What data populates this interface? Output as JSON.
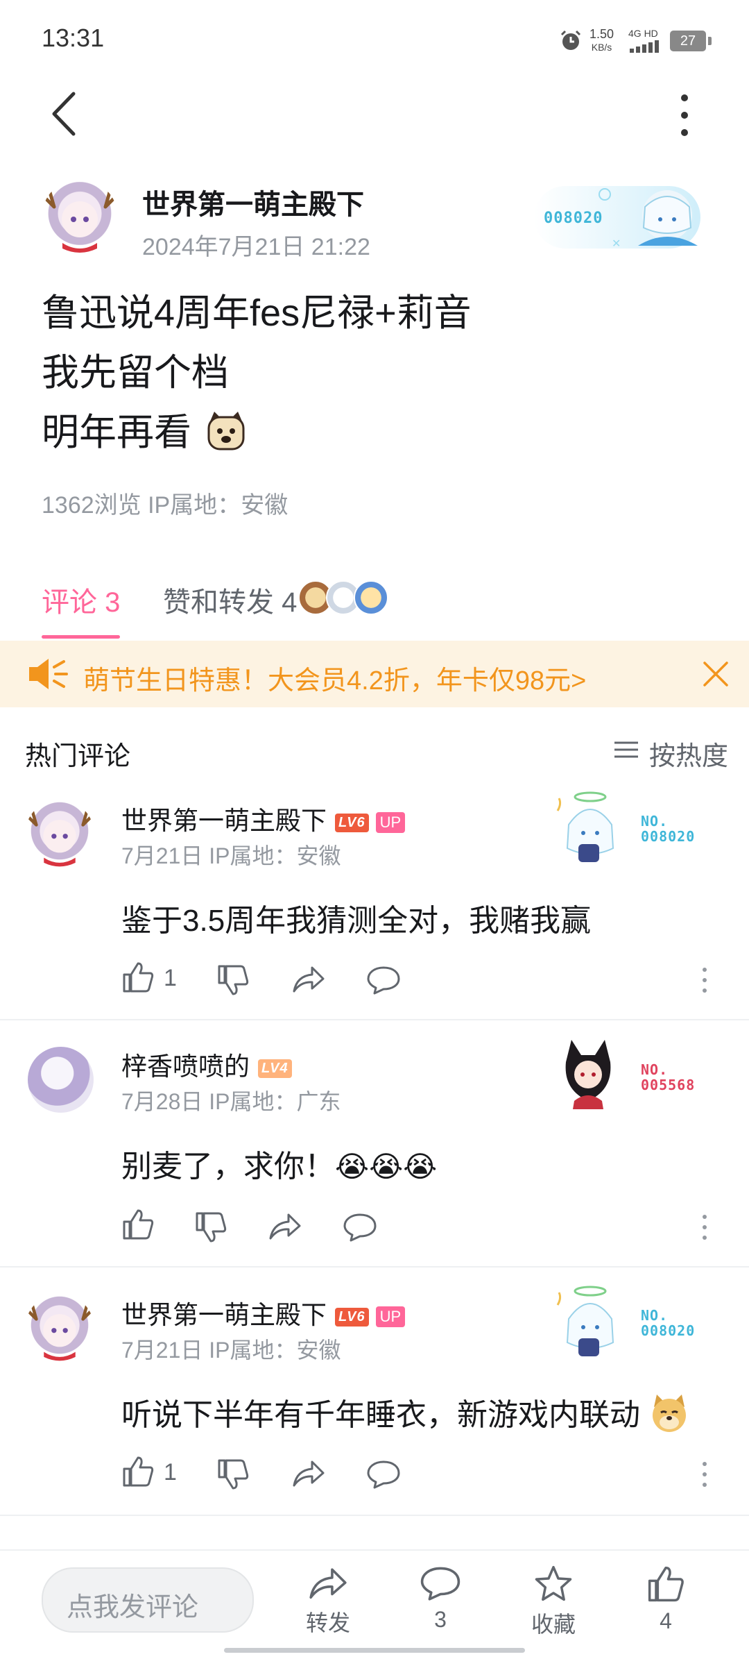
{
  "status_bar": {
    "time": "13:31",
    "speed_value": "1.50",
    "speed_unit": "KB/s",
    "network": "4G HD",
    "battery": "27"
  },
  "post": {
    "author": "世界第一萌主殿下",
    "time": "2024年7月21日 21:22",
    "fan_badge_no": "008020",
    "lines": [
      "鲁迅说4周年fes尼禄+莉音",
      "我先留个档",
      "明年再看"
    ],
    "stats": "1362浏览  IP属地：安徽"
  },
  "tabs": {
    "comments": "评论 3",
    "likes": "赞和转发 4"
  },
  "promo": {
    "text": "萌节生日特惠！大会员4.2折，年卡仅98元>"
  },
  "hot": {
    "title": "热门评论",
    "sort": "按热度"
  },
  "comments": [
    {
      "name": "世界第一萌主殿下",
      "level": "LV6",
      "up": "UP",
      "meta": "7月21日  IP属地：安徽",
      "text": "鉴于3.5周年我猜测全对，我赌我赢",
      "likes": "1",
      "badge_label": "NO.",
      "badge_no": "008020"
    },
    {
      "name": "梓香喷喷的",
      "level": "LV4",
      "meta": "7月28日  IP属地：广东",
      "text": "别麦了，求你！",
      "emoji": "😭😭😭",
      "likes": "",
      "badge_label": "NO.",
      "badge_no": "005568"
    },
    {
      "name": "世界第一萌主殿下",
      "level": "LV6",
      "up": "UP",
      "meta": "7月21日  IP属地：安徽",
      "text": "听说下半年有千年睡衣，新游戏内联动",
      "likes": "1",
      "badge_label": "NO.",
      "badge_no": "008020"
    }
  ],
  "bottom_bar": {
    "input_placeholder": "点我发评论",
    "share": "转发",
    "comment_count": "3",
    "favorite": "收藏",
    "like_count": "4"
  },
  "colors": {
    "accent": "#ff6699",
    "promo_text": "#f2951d",
    "badge_blue": "#3fb6d8",
    "badge_red": "#e0435e"
  }
}
